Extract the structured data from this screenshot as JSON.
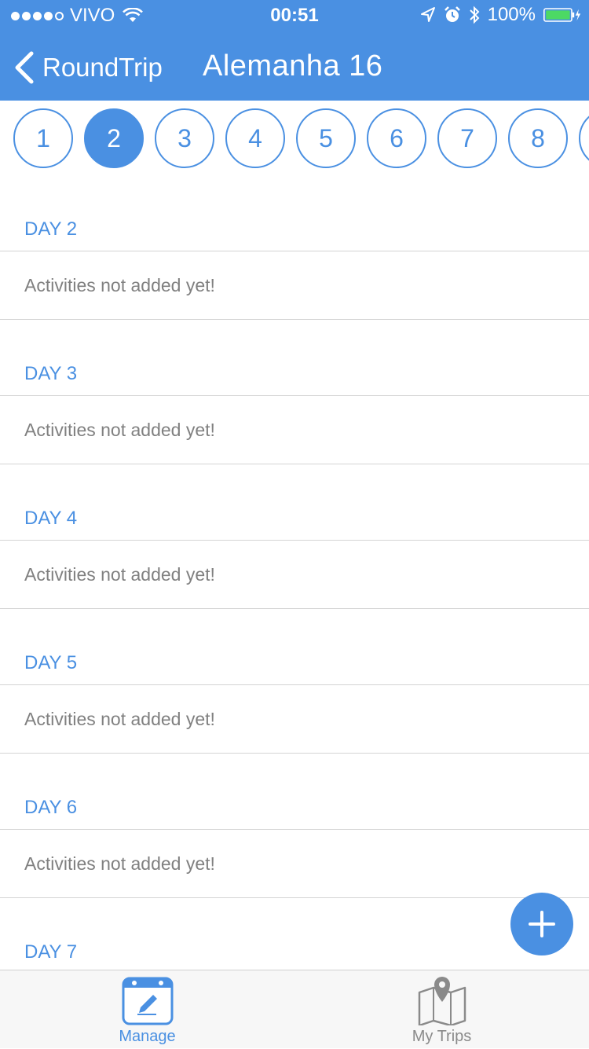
{
  "status_bar": {
    "carrier": "VIVO",
    "time": "00:51",
    "battery": "100%"
  },
  "nav": {
    "back_label": "RoundTrip",
    "title": "Alemanha 16"
  },
  "day_selector": {
    "days": [
      "1",
      "2",
      "3",
      "4",
      "5",
      "6",
      "7",
      "8",
      ""
    ],
    "selected": "2"
  },
  "sections": [
    {
      "header": "DAY 2",
      "activity": "Activities not added yet!"
    },
    {
      "header": "DAY 3",
      "activity": "Activities not added yet!"
    },
    {
      "header": "DAY 4",
      "activity": "Activities not added yet!"
    },
    {
      "header": "DAY 5",
      "activity": "Activities not added yet!"
    },
    {
      "header": "DAY 6",
      "activity": "Activities not added yet!"
    },
    {
      "header": "DAY 7",
      "activity": ""
    }
  ],
  "tab_bar": {
    "manage_label": "Manage",
    "trips_label": "My Trips"
  },
  "colors": {
    "accent": "#4a90e2",
    "text_muted": "#808080",
    "divider": "#d4d4d4",
    "battery_green": "#4cd964"
  },
  "icons": {
    "back": "chevron-left-icon",
    "add": "plus-icon",
    "manage": "calendar-pencil-icon",
    "trips": "map-pin-icon"
  }
}
